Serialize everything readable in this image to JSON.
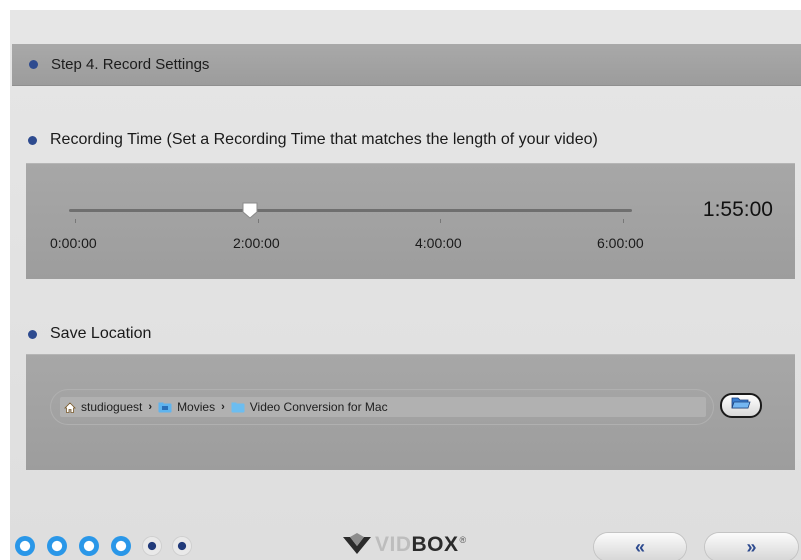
{
  "step": {
    "title": "Step 4. Record Settings"
  },
  "recording_time": {
    "label": "Recording Time (Set a Recording Time that matches the length of your video)",
    "ticks": [
      "0:00:00",
      "2:00:00",
      "4:00:00",
      "6:00:00"
    ],
    "value": "1:55:00",
    "slider_fraction": 0.319
  },
  "save_location": {
    "label": "Save Location",
    "path": [
      {
        "name": "studioguest",
        "icon": "home-icon"
      },
      {
        "name": "Movies",
        "icon": "movies-folder-icon"
      },
      {
        "name": "Video Conversion for Mac",
        "icon": "folder-icon"
      }
    ],
    "browse_icon": "open-folder-icon"
  },
  "footer": {
    "brand_light": "VID",
    "brand_dark": "BOX",
    "brand_mark": "®",
    "back_label": "«",
    "next_label": "»",
    "progress_dots": 6,
    "progress_current": 4
  },
  "colors": {
    "accent": "#2e4b8f",
    "dot_active": "#2a97e8",
    "panel": "#a3a3a3"
  }
}
